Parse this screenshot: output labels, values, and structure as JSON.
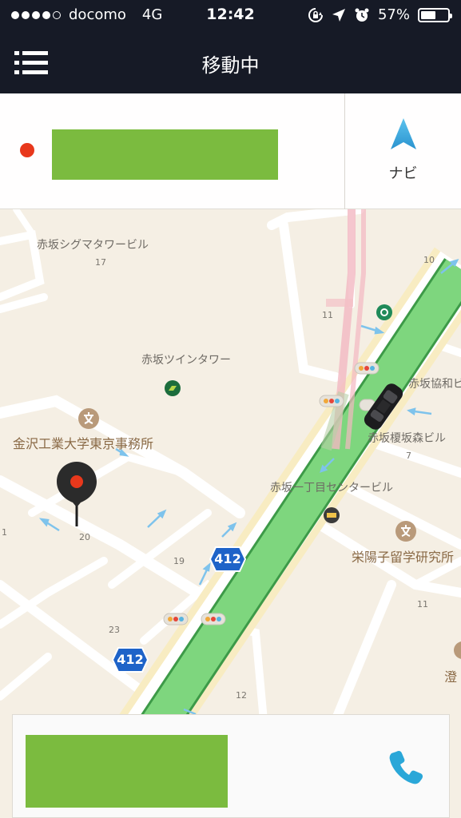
{
  "status_bar": {
    "carrier": "docomo",
    "network": "4G",
    "time": "12:42",
    "battery": "57%",
    "battery_level": 0.57
  },
  "nav": {
    "title": "移動中"
  },
  "destination": {
    "navi_label": "ナビ"
  },
  "map": {
    "labels": {
      "sigma": "赤坂シグマタワービル",
      "twin": "赤坂ツインタワー",
      "kanazawa": "金沢工業大学東京事務所",
      "kyowa": "赤坂協和ビ",
      "enoki": "赤坂榎坂森ビル",
      "center": "赤坂一丁目センタービル",
      "eiyoko": "栄陽子留学研究所",
      "sumi": "澄"
    },
    "numbers": {
      "n17": "17",
      "n10": "10",
      "n11a": "11",
      "n20": "20",
      "n19": "19",
      "n7": "7",
      "n23": "23",
      "n11b": "11",
      "n12": "12",
      "n1": "1"
    },
    "route_shields": [
      "412",
      "412"
    ],
    "colors": {
      "route": "#7ed67e",
      "route_edge": "#3d9a48",
      "pin": "#e8381c",
      "accent": "#3aa7de"
    }
  },
  "colors": {
    "header_bg": "#161a26",
    "placeholder_green": "#7bbb3f"
  }
}
